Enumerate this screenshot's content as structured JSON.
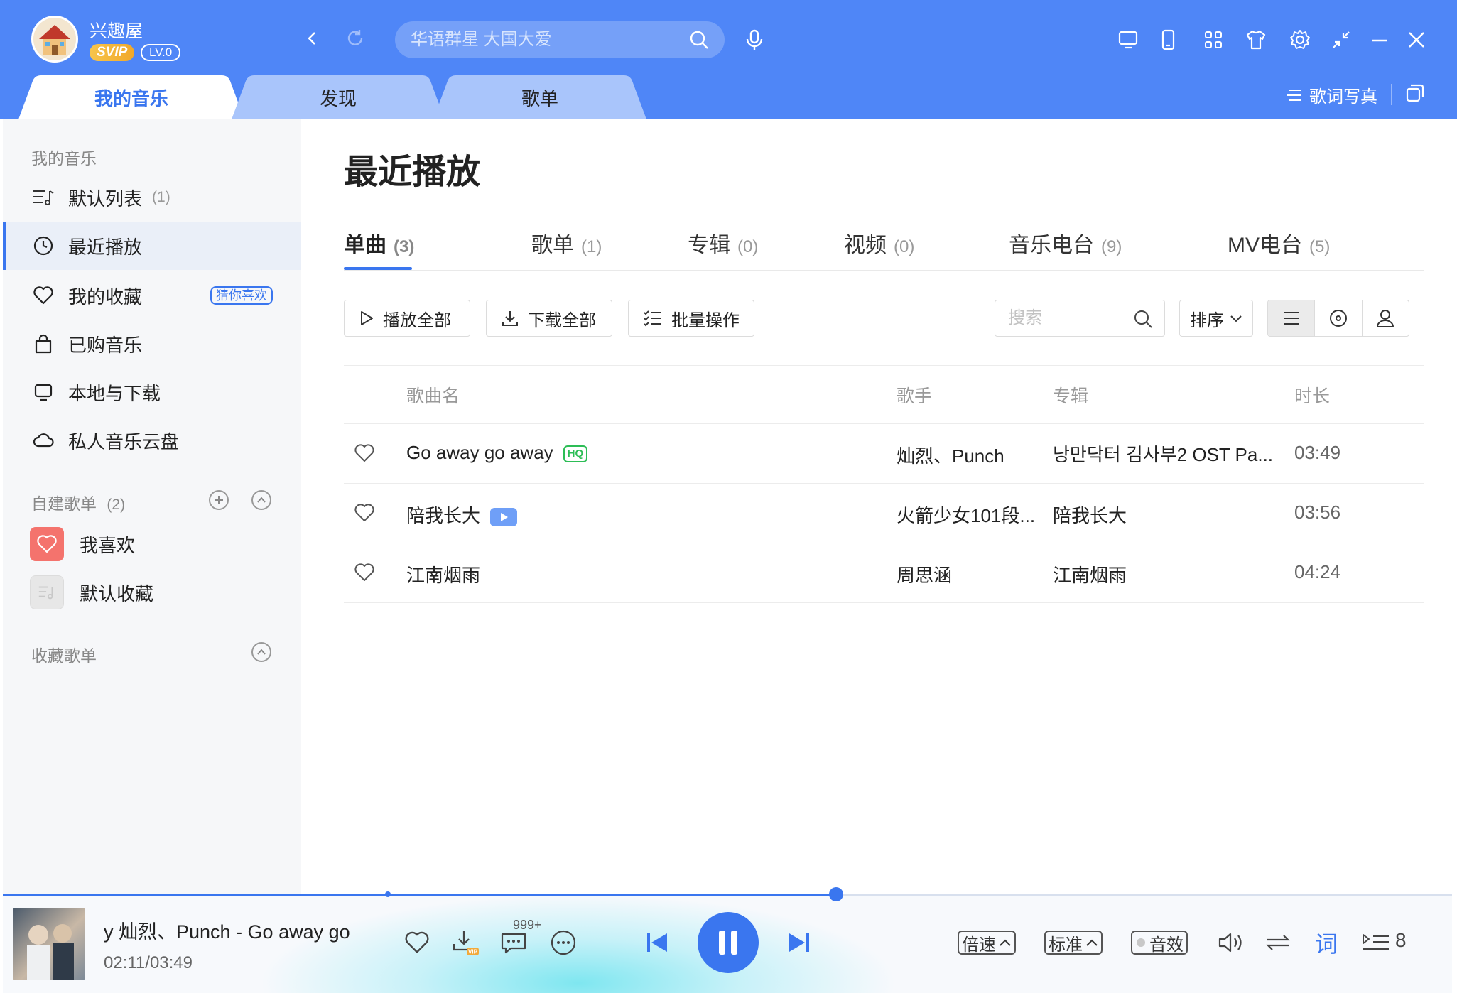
{
  "header": {
    "user": {
      "name": "兴趣屋",
      "svip": "SVIP",
      "level": "LV.0"
    },
    "search_placeholder": "华语群星 大国大爱",
    "tabs": [
      {
        "label": "我的音乐",
        "active": true
      },
      {
        "label": "发现",
        "active": false
      },
      {
        "label": "歌单",
        "active": false
      }
    ],
    "lyric_photo": "歌词写真",
    "accent_color": "#4f86f7"
  },
  "sidebar": {
    "section_title": "我的音乐",
    "items": [
      {
        "label": "默认列表",
        "count": "(1)",
        "icon": "playlist-icon"
      },
      {
        "label": "最近播放",
        "icon": "clock-icon",
        "active": true
      },
      {
        "label": "我的收藏",
        "badge": "猜你喜欢",
        "icon": "heart-icon"
      },
      {
        "label": "已购音乐",
        "icon": "bag-icon"
      },
      {
        "label": "本地与下载",
        "icon": "monitor-icon"
      },
      {
        "label": "私人音乐云盘",
        "icon": "cloud-icon"
      }
    ],
    "custom": {
      "title": "自建歌单",
      "count": "(2)",
      "items": [
        "我喜欢",
        "默认收藏"
      ]
    },
    "collected": {
      "title": "收藏歌单"
    }
  },
  "main": {
    "title": "最近播放",
    "tabs": [
      {
        "label": "单曲",
        "count": "(3)",
        "active": true
      },
      {
        "label": "歌单",
        "count": "(1)"
      },
      {
        "label": "专辑",
        "count": "(0)"
      },
      {
        "label": "视频",
        "count": "(0)"
      },
      {
        "label": "音乐电台",
        "count": "(9)"
      },
      {
        "label": "MV电台",
        "count": "(5)"
      }
    ],
    "actions": {
      "play_all": "播放全部",
      "download_all": "下载全部",
      "batch": "批量操作"
    },
    "search_placeholder": "搜索",
    "sort": "排序",
    "columns": {
      "name": "歌曲名",
      "artist": "歌手",
      "album": "专辑",
      "duration": "时长"
    },
    "songs": [
      {
        "name": "Go away go away",
        "tag": "HQ",
        "artist": "灿烈、Punch",
        "album": "낭만닥터 김사부2 OST Pa...",
        "duration": "03:49"
      },
      {
        "name": "陪我长大",
        "tag": "MV",
        "artist": "火箭少女101段...",
        "album": "陪我长大",
        "duration": "03:56"
      },
      {
        "name": "江南烟雨",
        "tag": "",
        "artist": "周思涵",
        "album": "江南烟雨",
        "duration": "04:24"
      }
    ]
  },
  "player": {
    "title": "y    灿烈、Punch - Go away go",
    "time": "02:11/03:49",
    "progress": 0.575,
    "comments": "999+",
    "speed": "倍速",
    "quality": "标准",
    "effect": "音效",
    "lyric": "词",
    "queue_count": "8"
  }
}
